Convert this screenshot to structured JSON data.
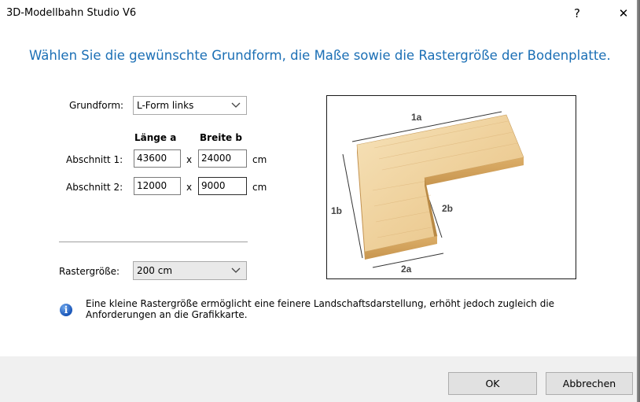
{
  "window": {
    "title": "3D-Modellbahn Studio V6",
    "help_glyph": "?",
    "close_glyph": "✕"
  },
  "heading": "Wählen Sie die gewünschte Grundform, die Maße sowie die Rastergröße der Bodenplatte.",
  "form": {
    "grundform_label": "Grundform:",
    "grundform_value": "L-Form links",
    "laenge_header": "Länge a",
    "breite_header": "Breite b",
    "abschnitt1": {
      "label": "Abschnitt 1:",
      "laenge": "43600",
      "x": "x",
      "breite": "24000",
      "unit": "cm"
    },
    "abschnitt2": {
      "label": "Abschnitt 2:",
      "laenge": "12000",
      "x": "x",
      "breite": "9000",
      "unit": "cm"
    },
    "raster_label": "Rastergröße:",
    "raster_value": "200 cm"
  },
  "preview": {
    "label_1a": "1a",
    "label_1b": "1b",
    "label_2a": "2a",
    "label_2b": "2b"
  },
  "info": "Eine kleine Rastergröße ermöglicht eine feinere Landschaftsdarstellung, erhöht jedoch zugleich die Anforderungen an die Grafikkarte.",
  "buttons": {
    "ok": "OK",
    "cancel": "Abbrechen"
  },
  "colors": {
    "heading": "#1b6fb5",
    "wood_light": "#f3d9a8",
    "wood_dark": "#d9b06a"
  },
  "icons": [
    "help-icon",
    "close-icon",
    "chevron-down-icon",
    "info-icon"
  ]
}
